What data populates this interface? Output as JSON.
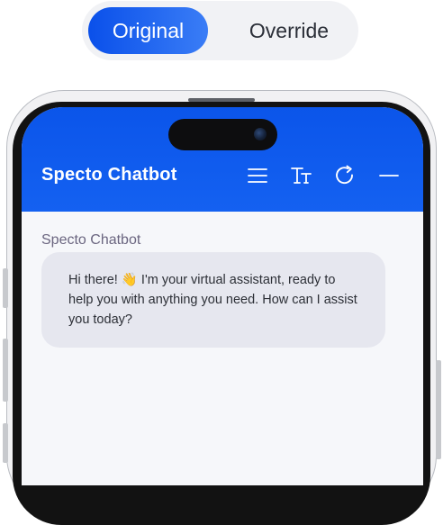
{
  "toggle": {
    "options": [
      "Original",
      "Override"
    ],
    "selected": "Original"
  },
  "chat": {
    "title": "Specto Chatbot",
    "header_icons": [
      "menu-icon",
      "text-size-icon",
      "refresh-icon",
      "minimize-icon"
    ],
    "messages": [
      {
        "sender": "Specto Chatbot",
        "text": "Hi there! 👋 I'm your virtual assistant, ready to help you with anything you need. How can I assist you today?"
      }
    ]
  },
  "colors": {
    "accent": "#0b55ea",
    "bubble_bg": "#e6e7ef",
    "chat_bg": "#f6f7fa",
    "toggle_bg": "#f1f2f5"
  }
}
